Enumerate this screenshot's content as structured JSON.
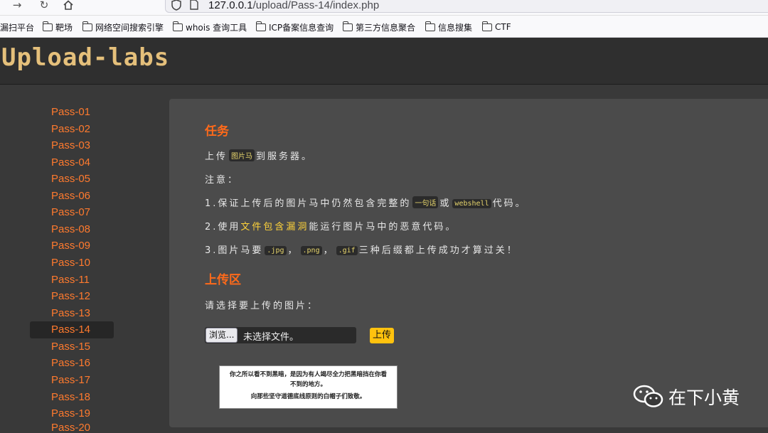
{
  "browser": {
    "url_host": "127.0.0.1",
    "url_path": "/upload/Pass-14/index.php",
    "bookmarks": [
      "漏扫平台",
      "靶场",
      "网络空间搜索引擎",
      "whois 查询工具",
      "ICP备案信息查询",
      "第三方信息聚合",
      "信息搜集",
      "CTF"
    ]
  },
  "header": {
    "logo_text": "Upload-labs"
  },
  "sidebar": {
    "items": [
      "Pass-01",
      "Pass-02",
      "Pass-03",
      "Pass-04",
      "Pass-05",
      "Pass-06",
      "Pass-07",
      "Pass-08",
      "Pass-09",
      "Pass-10",
      "Pass-11",
      "Pass-12",
      "Pass-13",
      "Pass-14",
      "Pass-15",
      "Pass-16",
      "Pass-17",
      "Pass-18",
      "Pass-19",
      "Pass-20"
    ],
    "active": "Pass-14"
  },
  "task": {
    "title": "任务",
    "line1_pre": "上传",
    "line1_code": "图片马",
    "line1_post": "到服务器。",
    "note_label": "注意：",
    "line2_pre": "1.保证上传后的图片马中仍然包含完整的",
    "line2_code1": "一句话",
    "line2_mid": "或",
    "line2_code2": "webshell",
    "line2_post": "代码。",
    "line3_pre": "2.使用",
    "line3_hl": "文件包含漏洞",
    "line3_post": "能运行图片马中的恶意代码。",
    "line4_pre": "3.图片马要",
    "line4_code1": ".jpg",
    "line4_sep1": "，",
    "line4_code2": ".png",
    "line4_sep2": "，",
    "line4_code3": ".gif",
    "line4_post": "三种后缀都上传成功才算过关！"
  },
  "upload": {
    "title": "上传区",
    "prompt": "请选择要上传的图片：",
    "browse_label": "浏览...",
    "file_status": "未选择文件。",
    "submit_label": "上传"
  },
  "note_image": {
    "line1": "你之所以看不到黑暗，是因为有人竭尽全力把黑暗挡在你看",
    "line2": "不到的地方。",
    "line3": "向那些坚守道德底线原则的白帽子们致敬。"
  },
  "watermark": {
    "text": "在下小黄"
  }
}
